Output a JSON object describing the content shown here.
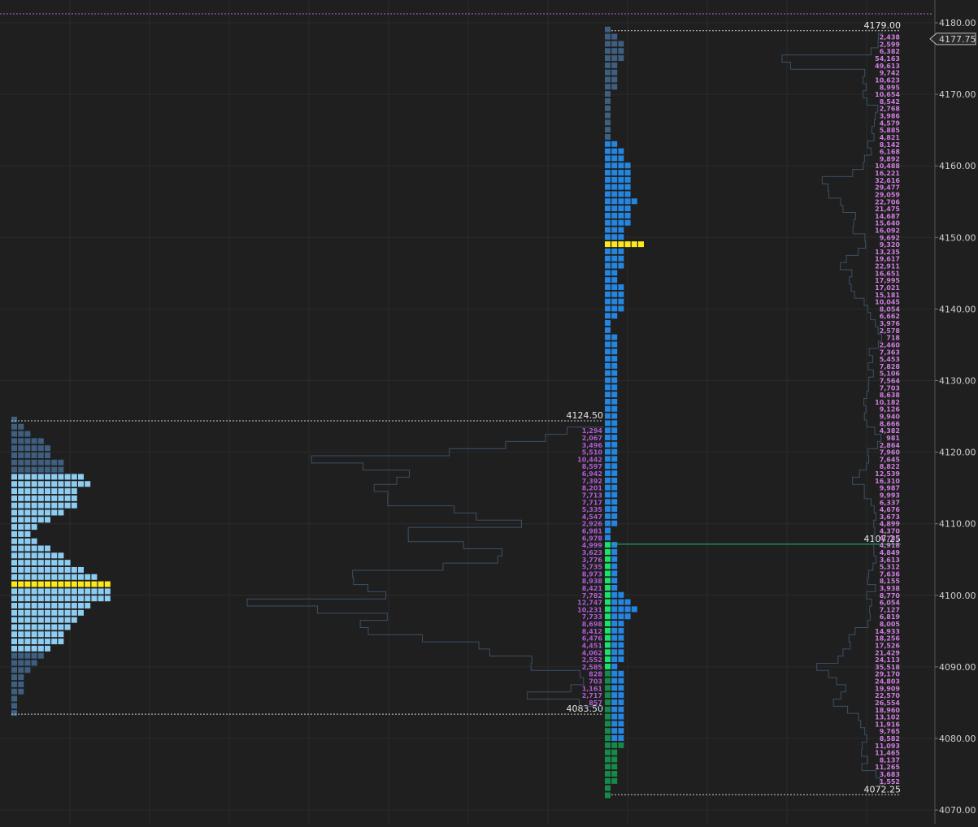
{
  "chart_data": {
    "type": "market-profile",
    "price_axis": {
      "ticks": [
        "4180.00",
        "4170.00",
        "4160.00",
        "4150.00",
        "4140.00",
        "4130.00",
        "4120.00",
        "4110.00",
        "4100.00",
        "4090.00",
        "4080.00",
        "4070.00"
      ],
      "tick_values": [
        4180,
        4170,
        4160,
        4150,
        4140,
        4130,
        4120,
        4110,
        4100,
        4090,
        4080,
        4070
      ],
      "range": [
        4069,
        4181
      ],
      "tick_size": 1.0,
      "current_price_label": "4177.75",
      "current_price": 4177.75,
      "gridlines": true
    },
    "colors": {
      "background": "#1f1f1f",
      "grid": "#2b2b2b",
      "profile_dark": "#3e5f80",
      "profile_light": "#8ecdf2",
      "profile_blue": "#2486e0",
      "poc": "#ffe81a",
      "green_bright": "#19e36a",
      "green_dark": "#168a48",
      "vol_purple": "#b05cd6",
      "vol_pink": "#d07fe0",
      "volume_outline": "#3a5068",
      "current_price_line": "#b46ad0",
      "last_price_line": "#1fbf6a",
      "range_line": "#cfcfcf"
    },
    "profiles": [
      {
        "name": "left",
        "high_label": "4124.50",
        "high": 4124.5,
        "low_label": "4083.50",
        "low": 4083.5,
        "poc": 4101.5,
        "tpo_counts": [
          [
            4124.5,
            1,
            "d"
          ],
          [
            4123.5,
            2,
            "d"
          ],
          [
            4122.5,
            3,
            "d"
          ],
          [
            4121.5,
            5,
            "d"
          ],
          [
            4120.5,
            6,
            "d"
          ],
          [
            4119.5,
            6,
            "d"
          ],
          [
            4118.5,
            8,
            "d"
          ],
          [
            4117.5,
            8,
            "d"
          ],
          [
            4116.5,
            11,
            "l"
          ],
          [
            4115.5,
            12,
            "l"
          ],
          [
            4114.5,
            10,
            "l"
          ],
          [
            4113.5,
            10,
            "l"
          ],
          [
            4112.5,
            10,
            "l"
          ],
          [
            4111.5,
            8,
            "l"
          ],
          [
            4110.5,
            6,
            "l"
          ],
          [
            4109.5,
            4,
            "l"
          ],
          [
            4108.5,
            3,
            "l"
          ],
          [
            4107.5,
            4,
            "l"
          ],
          [
            4106.5,
            6,
            "l"
          ],
          [
            4105.5,
            8,
            "l"
          ],
          [
            4104.5,
            9,
            "l"
          ],
          [
            4103.5,
            11,
            "l"
          ],
          [
            4102.5,
            13,
            "l"
          ],
          [
            4101.5,
            15,
            "p"
          ],
          [
            4100.5,
            15,
            "l"
          ],
          [
            4099.5,
            15,
            "l"
          ],
          [
            4098.5,
            12,
            "l"
          ],
          [
            4097.5,
            11,
            "l"
          ],
          [
            4096.5,
            10,
            "l"
          ],
          [
            4095.5,
            9,
            "l"
          ],
          [
            4094.5,
            8,
            "l"
          ],
          [
            4093.5,
            8,
            "l"
          ],
          [
            4092.5,
            6,
            "l"
          ],
          [
            4091.5,
            5,
            "d"
          ],
          [
            4090.5,
            4,
            "d"
          ],
          [
            4089.5,
            3,
            "d"
          ],
          [
            4088.5,
            2,
            "d"
          ],
          [
            4087.5,
            2,
            "d"
          ],
          [
            4086.5,
            2,
            "d"
          ],
          [
            4085.5,
            1,
            "d"
          ],
          [
            4084.5,
            1,
            "d"
          ],
          [
            4083.5,
            1,
            "d"
          ]
        ],
        "volume_labels": [
          "1,294",
          "2,067",
          "3,496",
          "5,510",
          "10,442",
          "8,597",
          "6,942",
          "7,392",
          "8,201",
          "7,713",
          "7,717",
          "5,335",
          "4,547",
          "2,926",
          "6,981",
          "6,978",
          "4,999",
          "3,623",
          "3,776",
          "5,735",
          "8,973",
          "8,938",
          "8,421",
          "7,782",
          "12,747",
          "10,231",
          "7,733",
          "8,698",
          "8,412",
          "6,476",
          "4,451",
          "4,062",
          "2,552",
          "2,585",
          "828",
          "703",
          "1,161",
          "2,717",
          "857"
        ],
        "volume_label_prices": [
          4123,
          4122,
          4121,
          4120,
          4119,
          4118,
          4117,
          4116,
          4115,
          4114,
          4113,
          4112,
          4111,
          4110,
          4109,
          4108,
          4107,
          4106,
          4105,
          4104,
          4103,
          4102,
          4101,
          4100,
          4099,
          4098,
          4097,
          4096,
          4095,
          4094,
          4093,
          4092,
          4091,
          4090,
          4089,
          4088,
          4087,
          4086,
          4085
        ]
      },
      {
        "name": "right",
        "high_label": "4179.00",
        "high": 4179.0,
        "low_label": "4072.25",
        "low": 4072.25,
        "poc": 4148.5,
        "last_price_label": "4107.25",
        "last_price": 4107.25,
        "tpo_counts": [
          [
            4179,
            1,
            "d"
          ],
          [
            4178,
            2,
            "d"
          ],
          [
            4177,
            3,
            "d"
          ],
          [
            4176,
            3,
            "d"
          ],
          [
            4175,
            3,
            "d"
          ],
          [
            4174,
            2,
            "d"
          ],
          [
            4173,
            2,
            "d"
          ],
          [
            4172,
            2,
            "d"
          ],
          [
            4171,
            2,
            "d"
          ],
          [
            4170,
            1,
            "d"
          ],
          [
            4169,
            1,
            "d"
          ],
          [
            4168,
            1,
            "d"
          ],
          [
            4167,
            1,
            "d"
          ],
          [
            4166,
            1,
            "d"
          ],
          [
            4165,
            1,
            "d"
          ],
          [
            4164,
            1,
            "d"
          ],
          [
            4163,
            2,
            "b"
          ],
          [
            4162,
            3,
            "b"
          ],
          [
            4161,
            3,
            "b"
          ],
          [
            4160,
            4,
            "b"
          ],
          [
            4159,
            4,
            "b"
          ],
          [
            4158,
            4,
            "b"
          ],
          [
            4157,
            4,
            "b"
          ],
          [
            4156,
            4,
            "b"
          ],
          [
            4155,
            5,
            "b"
          ],
          [
            4154,
            4,
            "b"
          ],
          [
            4153,
            4,
            "b"
          ],
          [
            4152,
            4,
            "b"
          ],
          [
            4151,
            3,
            "b"
          ],
          [
            4150,
            3,
            "b"
          ],
          [
            4149,
            6,
            "p"
          ],
          [
            4148,
            3,
            "b"
          ],
          [
            4147,
            3,
            "b"
          ],
          [
            4146,
            3,
            "b"
          ],
          [
            4145,
            2,
            "b"
          ],
          [
            4144,
            2,
            "b"
          ],
          [
            4143,
            3,
            "b"
          ],
          [
            4142,
            3,
            "b"
          ],
          [
            4141,
            3,
            "b"
          ],
          [
            4140,
            3,
            "b"
          ],
          [
            4139,
            2,
            "b"
          ],
          [
            4138,
            1,
            "b"
          ],
          [
            4137,
            1,
            "b"
          ],
          [
            4136,
            2,
            "b"
          ],
          [
            4135,
            2,
            "b"
          ],
          [
            4134,
            2,
            "b"
          ],
          [
            4133,
            2,
            "b"
          ],
          [
            4132,
            2,
            "b"
          ],
          [
            4131,
            2,
            "b"
          ],
          [
            4130,
            2,
            "b"
          ],
          [
            4129,
            2,
            "b"
          ],
          [
            4128,
            2,
            "b"
          ],
          [
            4127,
            2,
            "b"
          ],
          [
            4126,
            2,
            "b"
          ],
          [
            4125,
            2,
            "b"
          ],
          [
            4124,
            2,
            "b"
          ],
          [
            4123,
            2,
            "b"
          ],
          [
            4122,
            2,
            "b"
          ],
          [
            4121,
            2,
            "b"
          ],
          [
            4120,
            2,
            "b"
          ],
          [
            4119,
            2,
            "b"
          ],
          [
            4118,
            2,
            "b"
          ],
          [
            4117,
            2,
            "b"
          ],
          [
            4116,
            2,
            "b"
          ],
          [
            4115,
            2,
            "b"
          ],
          [
            4114,
            2,
            "b"
          ],
          [
            4113,
            2,
            "b"
          ],
          [
            4112,
            2,
            "b"
          ],
          [
            4111,
            2,
            "b"
          ],
          [
            4110,
            2,
            "b"
          ],
          [
            4109,
            1,
            "b"
          ],
          [
            4108,
            1,
            "b"
          ],
          [
            4107,
            2,
            "gb"
          ],
          [
            4106,
            2,
            "gb"
          ],
          [
            4105,
            2,
            "gb"
          ],
          [
            4104,
            2,
            "gb"
          ],
          [
            4103,
            2,
            "gb"
          ],
          [
            4102,
            2,
            "gb"
          ],
          [
            4101,
            2,
            "gb"
          ],
          [
            4100,
            3,
            "gb"
          ],
          [
            4099,
            4,
            "gb"
          ],
          [
            4098,
            5,
            "gb"
          ],
          [
            4097,
            4,
            "gb"
          ],
          [
            4096,
            3,
            "gb"
          ],
          [
            4095,
            3,
            "gb"
          ],
          [
            4094,
            3,
            "gb"
          ],
          [
            4093,
            3,
            "gb"
          ],
          [
            4092,
            3,
            "gb"
          ],
          [
            4091,
            3,
            "gb"
          ],
          [
            4090,
            2,
            "gb"
          ],
          [
            4089,
            3,
            "gd"
          ],
          [
            4088,
            3,
            "gd"
          ],
          [
            4087,
            3,
            "gd"
          ],
          [
            4086,
            3,
            "gd"
          ],
          [
            4085,
            3,
            "gd"
          ],
          [
            4084,
            3,
            "gd"
          ],
          [
            4083,
            3,
            "gd"
          ],
          [
            4082,
            3,
            "gd"
          ],
          [
            4081,
            3,
            "gd"
          ],
          [
            4080,
            3,
            "gd"
          ],
          [
            4079,
            3,
            "gd"
          ],
          [
            4078,
            2,
            "gd"
          ],
          [
            4077,
            2,
            "gd"
          ],
          [
            4076,
            2,
            "gd"
          ],
          [
            4075,
            2,
            "gd"
          ],
          [
            4074,
            2,
            "gd"
          ],
          [
            4073,
            1,
            "gd"
          ],
          [
            4072,
            1,
            "gd"
          ]
        ],
        "volume_labels": [
          "2,438",
          "2,599",
          "6,382",
          "54,163",
          "49,613",
          "9,742",
          "10,623",
          "8,995",
          "10,654",
          "8,542",
          "2,768",
          "3,986",
          "4,579",
          "5,885",
          "4,821",
          "8,142",
          "6,168",
          "9,892",
          "10,488",
          "16,221",
          "32,616",
          "29,477",
          "29,059",
          "22,706",
          "21,475",
          "14,687",
          "15,640",
          "16,092",
          "9,692",
          "9,320",
          "13,235",
          "19,617",
          "22,911",
          "16,651",
          "17,995",
          "17,021",
          "15,181",
          "10,045",
          "8,054",
          "6,662",
          "3,976",
          "2,578",
          "718",
          "2,460",
          "7,363",
          "5,453",
          "7,828",
          "5,106",
          "7,564",
          "7,703",
          "8,638",
          "10,182",
          "9,126",
          "9,940",
          "8,666",
          "4,382",
          "981",
          "2,864",
          "7,960",
          "7,645",
          "8,822",
          "12,539",
          "16,310",
          "9,987",
          "9,993",
          "6,337",
          "4,676",
          "3,673",
          "4,899",
          "4,370",
          "4,785",
          "4,918",
          "4,849",
          "3,613",
          "5,312",
          "7,636",
          "8,155",
          "3,938",
          "8,770",
          "6,054",
          "7,127",
          "6,819",
          "8,005",
          "14,933",
          "18,256",
          "17,526",
          "21,429",
          "24,113",
          "35,518",
          "29,170",
          "24,803",
          "19,909",
          "22,570",
          "26,554",
          "18,960",
          "13,102",
          "11,916",
          "9,765",
          "8,582",
          "11,093",
          "11,465",
          "8,137",
          "11,265",
          "3,683",
          "1,552"
        ],
        "volume_label_start_price": 4178,
        "volume_label_step": -1
      }
    ]
  }
}
